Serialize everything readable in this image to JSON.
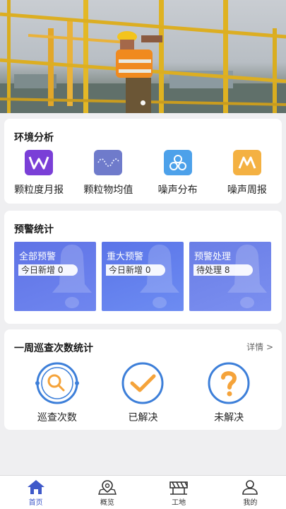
{
  "banner": {
    "slide_count": 3,
    "active_slide": 1
  },
  "env": {
    "title": "环境分析",
    "items": [
      {
        "label": "颗粒度月报",
        "icon": "w-icon",
        "color": "#7a3fd7"
      },
      {
        "label": "颗粒物均值",
        "icon": "wave-icon",
        "color": "#6f7bcb"
      },
      {
        "label": "噪声分布",
        "icon": "hexagon-cluster-icon",
        "color": "#4da1ea"
      },
      {
        "label": "噪声周报",
        "icon": "m-icon",
        "color": "#f4b142"
      }
    ]
  },
  "warn": {
    "title": "预警统计",
    "tiles": [
      {
        "name": "全部预警",
        "pill": "今日新增 0"
      },
      {
        "name": "重大预警",
        "pill": "今日新增 0"
      },
      {
        "name": "预警处理",
        "pill": "待处理 8"
      }
    ]
  },
  "patrol": {
    "title": "一周巡查次数统计",
    "more": "详情 >",
    "items": [
      {
        "label": "巡查次数",
        "icon": "search-circle-icon"
      },
      {
        "label": "已解决",
        "icon": "check-icon"
      },
      {
        "label": "未解决",
        "icon": "question-icon"
      }
    ]
  },
  "tabbar": {
    "tabs": [
      {
        "label": "首页",
        "icon": "home-icon",
        "active": true
      },
      {
        "label": "概览",
        "icon": "map-pin-icon",
        "active": false
      },
      {
        "label": "工地",
        "icon": "barrier-icon",
        "active": false
      },
      {
        "label": "我的",
        "icon": "user-icon",
        "active": false
      }
    ]
  },
  "colors": {
    "accent": "#3f59c9",
    "tile_blue": "#6179e6",
    "patrol_blue": "#3d7fd9",
    "patrol_orange": "#f5a33a"
  }
}
